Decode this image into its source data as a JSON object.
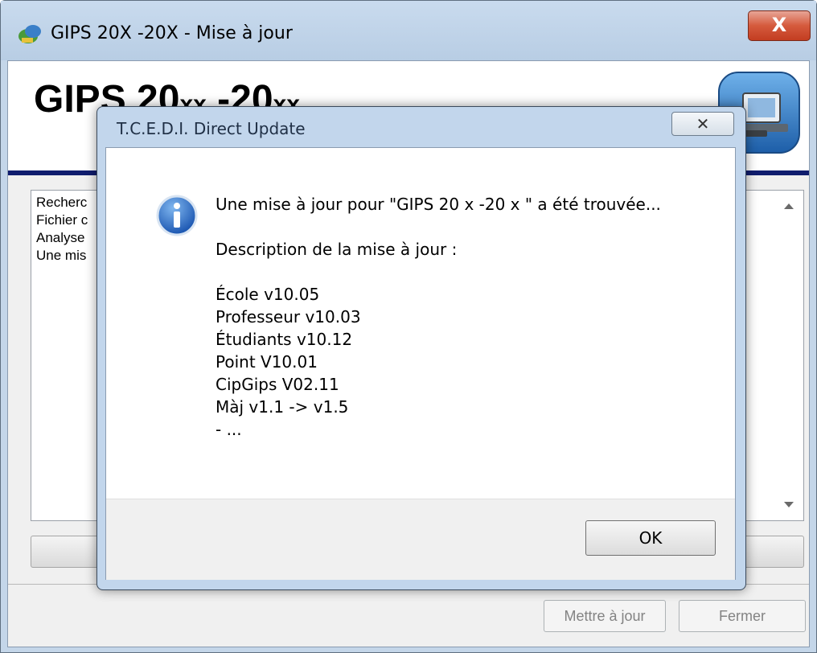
{
  "main_window": {
    "title": "GIPS 20X -20X  - Mise à jour",
    "close_label": "X",
    "header": {
      "title_part1": "GIPS 20",
      "title_sub1": "xx",
      "title_part2": " -20",
      "title_sub2": "xx"
    },
    "log_lines": [
      "Recherc",
      "Fichier c",
      "Analyse",
      "Une mis"
    ],
    "buttons": {
      "update_label": "Mettre à jour",
      "close_label": "Fermer"
    }
  },
  "dialog": {
    "title": "T.C.E.D.I. Direct Update",
    "close_label": "✕",
    "message": "Une mise à jour pour \"GIPS 20 x -20 x \" a été trouvée...",
    "description_label": "Description de la mise à jour :",
    "items": [
      "École v10.05",
      "Professeur v10.03",
      "Étudiants v10.12",
      "Point V10.01",
      "CipGips V02.11",
      "Màj v1.1 -> v1.5",
      "- ..."
    ],
    "ok_label": "OK"
  }
}
